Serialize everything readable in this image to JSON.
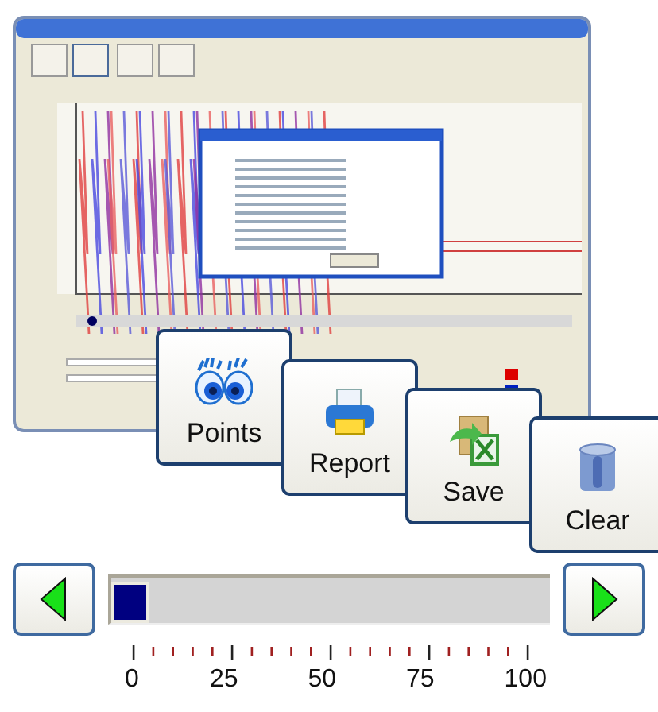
{
  "buttons": [
    {
      "label": "Points",
      "kind": "eyes"
    },
    {
      "label": "Report",
      "kind": "printer"
    },
    {
      "label": "Save",
      "kind": "export"
    },
    {
      "label": "Clear",
      "kind": "bin"
    }
  ],
  "slider": {
    "level": 0,
    "scale_labels": [
      "0",
      "25",
      "50",
      "75",
      "100"
    ]
  }
}
